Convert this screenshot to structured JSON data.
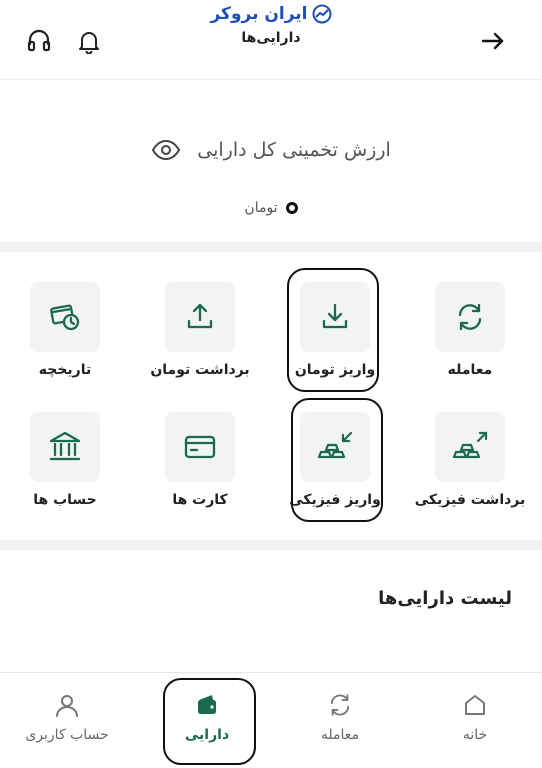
{
  "brand": {
    "name": "ایران بروکر",
    "logo_color": "#1f4fb8"
  },
  "header": {
    "title": "دارایی‌ها",
    "back_icon": "arrow-right-icon",
    "notification_icon": "bell-icon",
    "support_icon": "headset-icon"
  },
  "summary": {
    "estimated_label": "ارزش تخمینی کل دارایی",
    "visibility_icon": "eye-icon",
    "currency_option": "تومان"
  },
  "actions": [
    {
      "label": "معامله",
      "icon": "exchange-icon",
      "highlighted": false
    },
    {
      "label": "واریز تومان",
      "icon": "download-icon",
      "highlighted": true
    },
    {
      "label": "برداشت تومان",
      "icon": "upload-icon",
      "highlighted": false
    },
    {
      "label": "تاریخچه",
      "icon": "history-icon",
      "highlighted": false
    },
    {
      "label": "برداشت فیزیکی",
      "icon": "gold-withdraw-icon",
      "highlighted": false
    },
    {
      "label": "واریز فیزیکی",
      "icon": "gold-deposit-icon",
      "highlighted": true
    },
    {
      "label": "کارت ها",
      "icon": "card-icon",
      "highlighted": false
    },
    {
      "label": "حساب ها",
      "icon": "bank-icon",
      "highlighted": false
    }
  ],
  "assets_list": {
    "title": "لیست دارایی‌ها"
  },
  "bottom_nav": [
    {
      "label": "خانه",
      "icon": "home-icon",
      "active": false
    },
    {
      "label": "معامله",
      "icon": "exchange-icon",
      "active": false
    },
    {
      "label": "دارایی",
      "icon": "wallet-icon",
      "active": true
    },
    {
      "label": "حساب کاربری",
      "icon": "user-icon",
      "active": false
    }
  ],
  "colors": {
    "accent": "#1a6a52",
    "tile_bg": "#f2f3f3",
    "text": "#222222",
    "muted": "#666666"
  }
}
